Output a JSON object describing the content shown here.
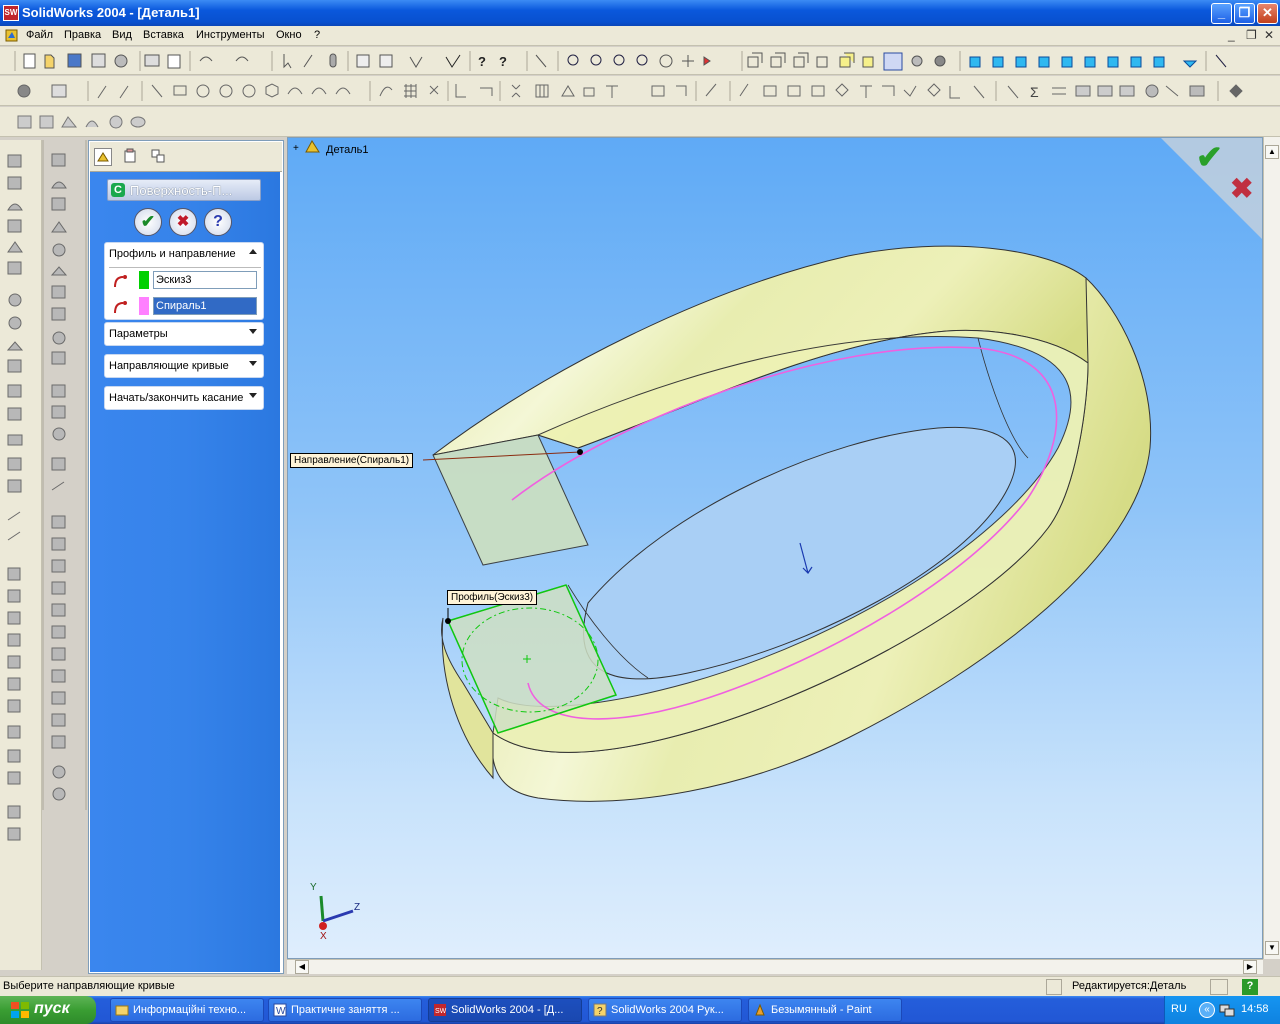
{
  "window": {
    "title": "SolidWorks 2004 - [Деталь1]",
    "app_icon_text": "SW",
    "minimize": "_",
    "maximize": "❐",
    "close": "✕"
  },
  "menu": {
    "items": [
      "Файл",
      "Правка",
      "Вид",
      "Вставка",
      "Инструменты",
      "Окно",
      "?"
    ],
    "mdi_minimize": "_",
    "mdi_restore": "❐",
    "mdi_close": "✕"
  },
  "property_manager": {
    "feature_title": "Поверхность-П...",
    "ok": "✔",
    "cancel": "✖",
    "help": "?",
    "groups": {
      "profile_path": {
        "title": "Профиль и направление",
        "profile_value": "Эскиз3",
        "path_value": "Спираль1",
        "profile_color": "#00d000",
        "path_color": "#ff80ff"
      },
      "options": {
        "title": "Параметры"
      },
      "guide_curves": {
        "title": "Направляющие кривые"
      },
      "tangency": {
        "title": "Начать/закончить касание"
      }
    }
  },
  "graphics": {
    "tree_root": "Деталь1",
    "tree_expand": "+",
    "callout_path": "Направление(Спираль1)",
    "callout_profile": "Профиль(Эскиз3)",
    "confirm_ok": "✔",
    "confirm_cancel": "✖",
    "axis_x": "X",
    "axis_y": "Y",
    "axis_z": "Z",
    "colors": {
      "surface": "#eef2a8",
      "path_curve": "#f060e0",
      "profile_curve": "#10c810",
      "ok_check": "#2aa02a",
      "cancel_x": "#c03040"
    }
  },
  "statusbar": {
    "message": "Выберите направляющие кривые",
    "mode": "Редактируется:Деталь",
    "help": "?"
  },
  "taskbar": {
    "start": "пуск",
    "tasks": [
      "Информаційні техно...",
      "Практичне заняття ...",
      "SolidWorks 2004 - [Д...",
      "SolidWorks 2004 Рук...",
      "Безымянный - Paint"
    ],
    "lang": "RU",
    "time": "14:58"
  }
}
